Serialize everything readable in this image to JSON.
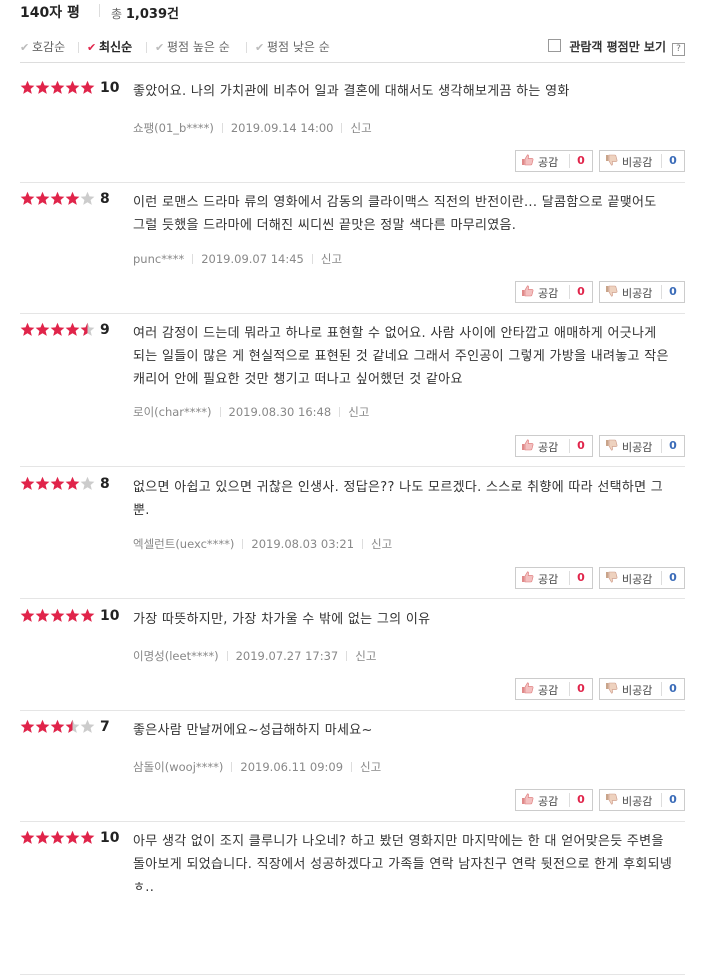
{
  "header": {
    "title": "140자 평",
    "total_prefix": "총",
    "total_count": "1,039건"
  },
  "sort": {
    "options": [
      {
        "label": "호감순",
        "active": false
      },
      {
        "label": "최신순",
        "active": true
      },
      {
        "label": "평점 높은 순",
        "active": false
      },
      {
        "label": "평점 낮은 순",
        "active": false
      }
    ],
    "audience_only_label": "관람객 평점만 보기",
    "help_label": "?"
  },
  "colors": {
    "star_on": "#e0244a",
    "star_off": "#cccccc",
    "like_count": "#e0244a",
    "dislike_count": "#3a6bb8"
  },
  "buttons": {
    "like_label": "공감",
    "dislike_label": "비공감",
    "report_label": "신고"
  },
  "reviews": [
    {
      "score": "10",
      "rating": 10,
      "text": "좋았어요. 나의 가치관에 비추어 일과 결혼에 대해서도 생각해보게끔 하는 영화",
      "author": "쇼팽(01_b****)",
      "date": "2019.09.14 14:00",
      "likes": "0",
      "dislikes": "0"
    },
    {
      "score": "8",
      "rating": 8,
      "text": "이런 로맨스 드라마 류의 영화에서 감동의 클라이맥스 직전의 반전이란... 달콤함으로 끝맺어도 그럴 듯했을 드라마에 더해진 씨디씬 끝맛은 정말 색다른 마무리였음.",
      "author": "punc****",
      "date": "2019.09.07 14:45",
      "likes": "0",
      "dislikes": "0"
    },
    {
      "score": "9",
      "rating": 9,
      "text": "여러 감정이 드는데 뭐라고 하나로 표현할 수 없어요. 사람 사이에 안타깝고 애매하게 어긋나게 되는 일들이 많은 게 현실적으로 표현된 것 같네요 그래서 주인공이 그렇게 가방을 내려놓고 작은 캐리어 안에 필요한 것만 챙기고 떠나고 싶어했던 것 같아요",
      "author": "로이(char****)",
      "date": "2019.08.30 16:48",
      "likes": "0",
      "dislikes": "0"
    },
    {
      "score": "8",
      "rating": 8,
      "text": "없으면 아쉽고 있으면 귀찮은 인생사. 정답은?? 나도 모르겠다. 스스로 취향에 따라 선택하면 그 뿐.",
      "author": "엑셀런트(uexc****)",
      "date": "2019.08.03 03:21",
      "likes": "0",
      "dislikes": "0"
    },
    {
      "score": "10",
      "rating": 10,
      "text": "가장 따뜻하지만, 가장 차가울 수 밖에 없는 그의 이유",
      "author": "이명성(leet****)",
      "date": "2019.07.27 17:37",
      "likes": "0",
      "dislikes": "0"
    },
    {
      "score": "7",
      "rating": 7,
      "text": "좋은사람 만날꺼에요~성급해하지 마세요~",
      "author": "삼돌이(wooj****)",
      "date": "2019.06.11 09:09",
      "likes": "0",
      "dislikes": "0"
    },
    {
      "score": "10",
      "rating": 10,
      "text": "아무 생각 없이 조지 클루니가 나오네? 하고 봤던 영화지만 마지막에는 한 대 얻어맞은듯 주변을 돌아보게 되었습니다. 직장에서 성공하겠다고 가족들 연락 남자친구 연락 뒷전으로 한게 후회되넹 ㅎ..",
      "author": "",
      "date": "",
      "likes": "",
      "dislikes": ""
    }
  ]
}
